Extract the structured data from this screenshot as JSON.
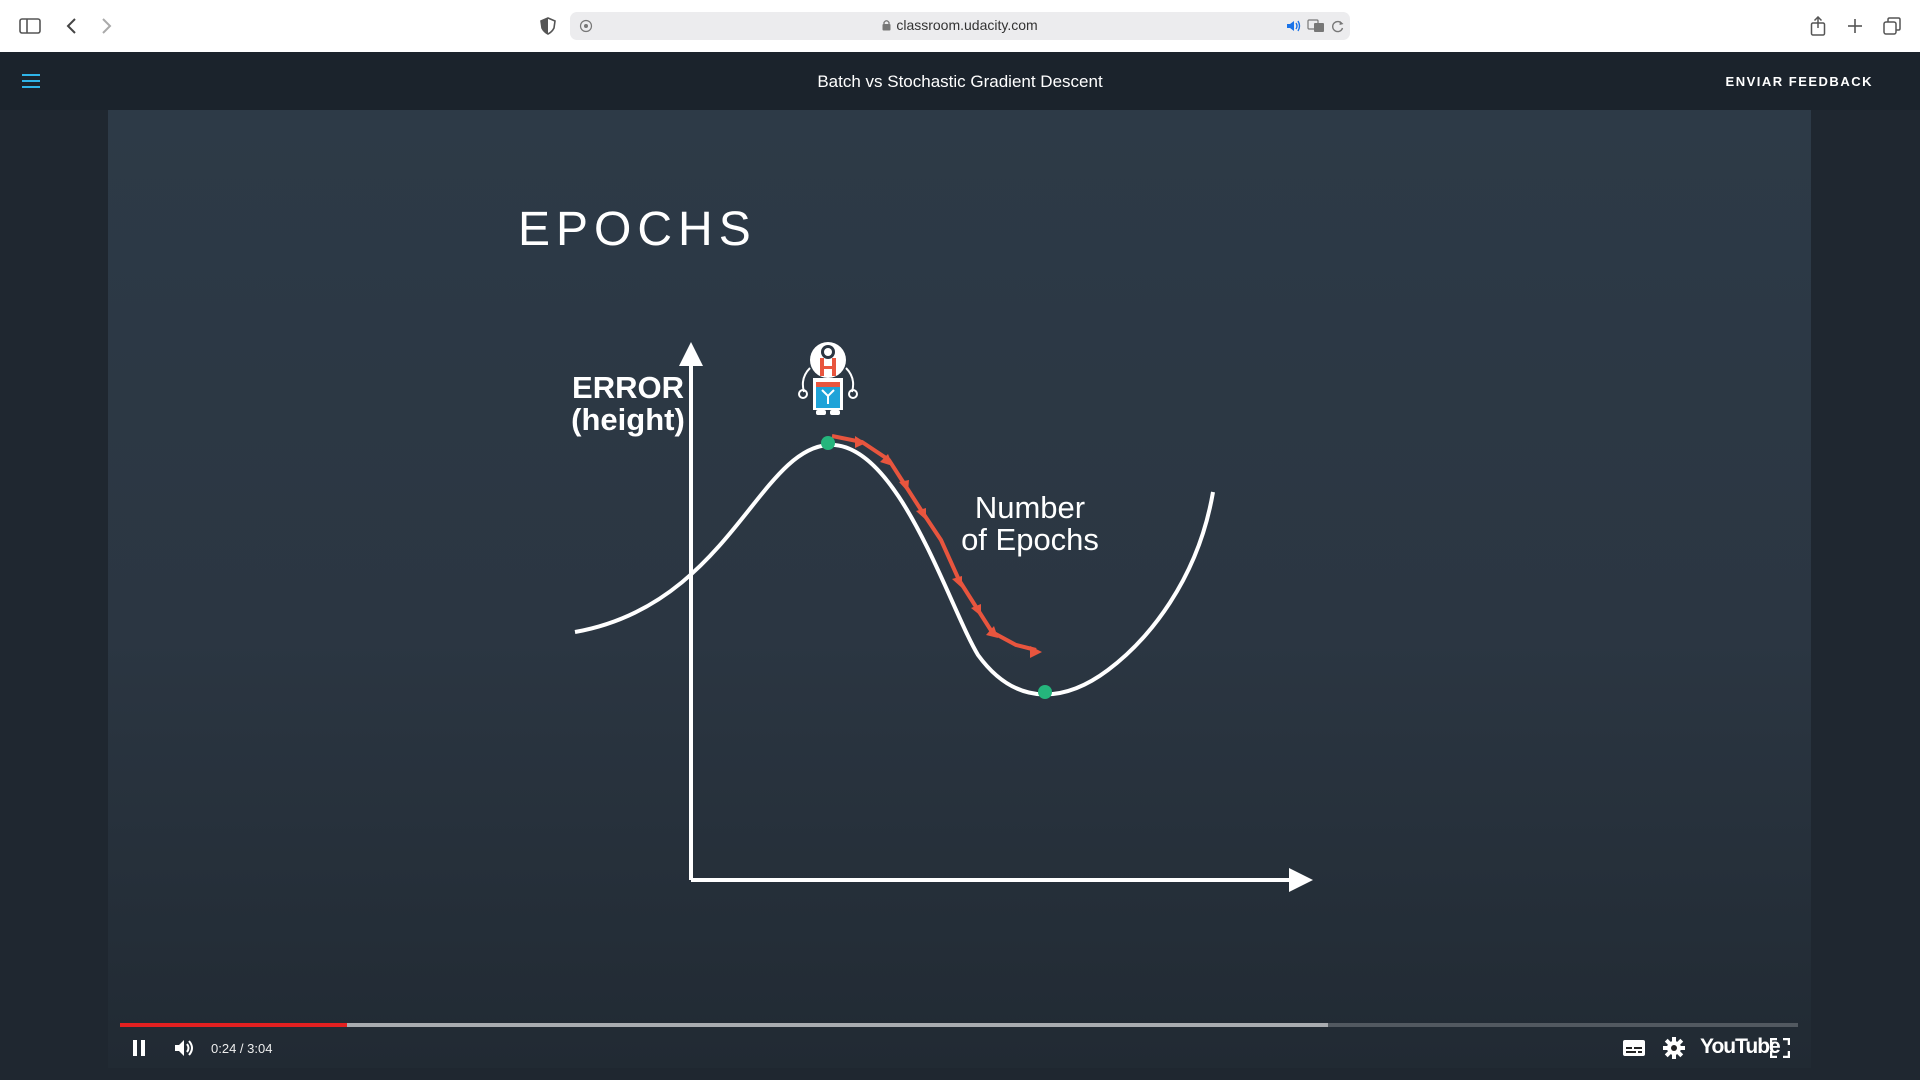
{
  "browser": {
    "url": "classroom.udacity.com",
    "icons": [
      "sidebar-icon",
      "back-icon",
      "forward-icon",
      "shield-icon",
      "site-settings-icon",
      "speaker-icon",
      "translate-icon",
      "reload-icon",
      "share-icon",
      "new-tab-icon",
      "tabs-overview-icon"
    ]
  },
  "header": {
    "title": "Batch vs Stochastic Gradient Descent",
    "feedback_label": "ENVIAR FEEDBACK",
    "menu_icon": "hamburger-icon",
    "accent": "#2fb4e8"
  },
  "slide": {
    "title": "EPOCHS",
    "y_label": "ERROR\n(height)",
    "curve_label": "Number\nof Epochs",
    "colors": {
      "arrow": "#e8553e",
      "point": "#25b57c",
      "curve": "#ffffff"
    }
  },
  "player": {
    "time": "0:24 / 3:04",
    "progress_fraction": 0.135,
    "buffered_fraction": 0.72,
    "colors": {
      "played": "#e32020"
    },
    "icons": [
      "pause-icon",
      "volume-icon",
      "subtitles-icon",
      "settings-icon",
      "fullscreen-icon"
    ],
    "logo": "YouTube"
  }
}
